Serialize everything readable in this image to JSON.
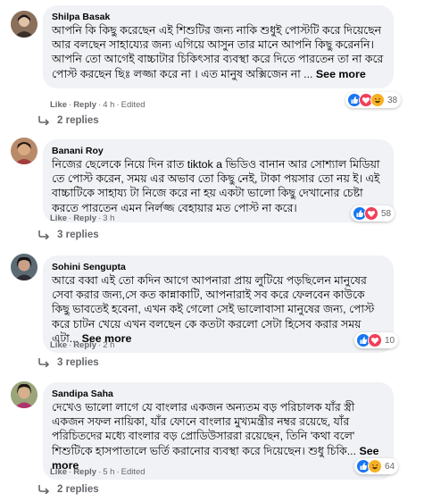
{
  "comments": [
    {
      "author": "Shilpa Basak",
      "text": "আপনি কি কিছু করেছেন এই শিশুটির জন্য নাকি শুধুই পোস্টটি করে দিয়েছেন আর বলছেন সাহায্যের জন্য এগিয়ে আসুন তার মানে আপনি কিছু করেননি। আপনি তো আগেই বাচ্চাটার চিকিৎসার ব্যবস্থা করে দিতে পারতেন তা না করে পোস্ট করছেন ছিঃ লজ্জা করে না । এত মানুষ অক্সিজেন না ...",
      "see_more": "See more",
      "like": "Like",
      "reply": "Reply",
      "time": "4 h",
      "edited": "Edited",
      "reaction_count": "38",
      "reaction_icons": [
        "like-icon",
        "love-icon",
        "haha-icon"
      ],
      "replies_label": "2 replies"
    },
    {
      "author": "Banani Roy",
      "text": "নিজের ছেলেকে নিয়ে দিন রাত tiktok a ভিডিও বানান আর সোশ্যাল মিডিয়া তে পোস্ট করেন, সময় এর অভাব তো কিছু নেই, টাকা পয়সার তো নয় ই। এই বাচ্চাটিকে সাহায্য টা নিজে করে না হয় একটা ভালো কিছু দেখানোর চেষ্টা করতে পারতেন এমন নির্লজ্জ বেহায়ার মত পোস্ট না করে।",
      "see_more": "",
      "like": "Like",
      "reply": "Reply",
      "time": "3 h",
      "edited": "",
      "reaction_count": "58",
      "reaction_icons": [
        "like-icon",
        "love-icon"
      ],
      "replies_label": "3 replies"
    },
    {
      "author": "Sohini Sengupta",
      "text": "আরে বব্বা এই তো কদিন আগে আপনারা প্রায় লুটিয়ে পড়ছিলেন মানুষের সেবা করার জন্য,সে কত কান্নাকাটি, আপনারাই সব করে ফেলবেন কাউকে কিছু ভাবতেই হবেনা, এখন কই গেলো সেই ভালোবাসা মানুষের জন্য, পোস্ট করে চাটন খেয়ে এখন বলছেন কে কতটা করলো সেটা হিসেব করার সময় এটা...",
      "see_more": "See more",
      "like": "Like",
      "reply": "Reply",
      "time": "2 h",
      "edited": "",
      "reaction_count": "10",
      "reaction_icons": [
        "like-icon",
        "love-icon"
      ],
      "replies_label": "3 replies"
    },
    {
      "author": "Sandipa Saha",
      "text": "দেখেও ভালো লাগে যে বাংলার একজন অন্যতম বড় পরিচালক যাঁর স্ত্রী একজন সফল নায়িকা, যাঁর ফোনে বাংলার মুখ্যমন্ত্রীর নম্বর রয়েছে, যাঁর পরিচিতদের মধ্যে বাংলার বড় প্রোডিউসাররা রয়েছেন, তিনি 'কথা বলে' শিশুটিকে হাসপাতালে ভর্তি করানোর ব্যবস্থা করে দিয়েছেন। শুধু চিকি...",
      "see_more": "See more",
      "like": "Like",
      "reply": "Reply",
      "time": "5 h",
      "edited": "Edited",
      "reaction_count": "64",
      "reaction_icons": [
        "like-icon",
        "haha-icon"
      ],
      "replies_label": "2 replies"
    }
  ],
  "colors": {
    "bubble": "#f0f2f5",
    "meta": "#65676b",
    "like_blue": "#1877f2",
    "love_red": "#f33e58",
    "haha_yellow": "#f7b125"
  }
}
